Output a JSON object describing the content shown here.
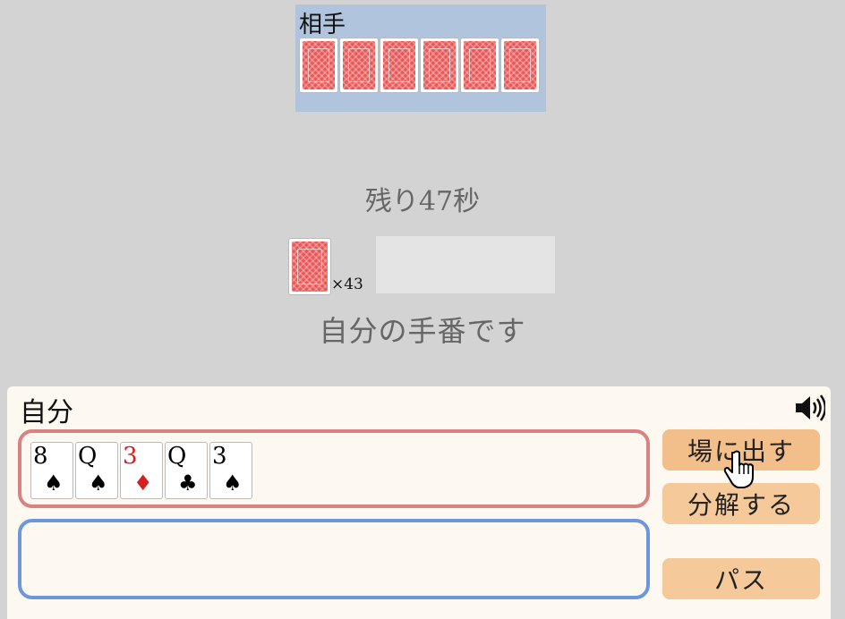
{
  "opponent": {
    "label": "相手",
    "card_count": 6
  },
  "timer": "残り47秒",
  "deck": {
    "count_label": "×43"
  },
  "turn_message": "自分の手番です",
  "player": {
    "label": "自分",
    "hand": [
      {
        "rank": "8",
        "suit": "♠",
        "color": "#000000"
      },
      {
        "rank": "Q",
        "suit": "♠",
        "color": "#000000"
      },
      {
        "rank": "3",
        "suit": "♦",
        "color": "#d62020"
      },
      {
        "rank": "Q",
        "suit": "♣",
        "color": "#000000"
      },
      {
        "rank": "3",
        "suit": "♠",
        "color": "#000000"
      }
    ]
  },
  "buttons": {
    "play": "場に出す",
    "split": "分解する",
    "pass": "パス"
  },
  "icons": {
    "sound": "speaker-icon",
    "cursor": "hand-pointer-icon"
  },
  "colors": {
    "card_back": "#e85656",
    "opponent_area": "#b0c4de",
    "hand_border": "#d98282",
    "selection_border": "#6d96dd",
    "button": "#f5c999"
  }
}
